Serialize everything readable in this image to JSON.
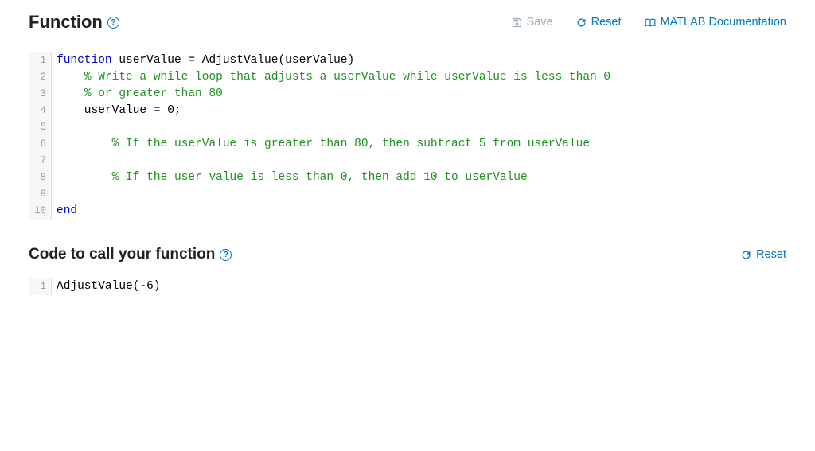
{
  "header": {
    "title": "Function",
    "actions": {
      "save": "Save",
      "reset": "Reset",
      "docs": "MATLAB Documentation"
    }
  },
  "editor1": {
    "lines": [
      {
        "n": "1",
        "segs": [
          {
            "t": "function",
            "c": "kw"
          },
          {
            "t": " userValue = AdjustValue(userValue)",
            "c": ""
          }
        ]
      },
      {
        "n": "2",
        "segs": [
          {
            "t": "    ",
            "c": ""
          },
          {
            "t": "% Write a while loop that adjusts a userValue while userValue is less than 0",
            "c": "cm"
          }
        ]
      },
      {
        "n": "3",
        "segs": [
          {
            "t": "    ",
            "c": ""
          },
          {
            "t": "% or greater than 80",
            "c": "cm"
          }
        ]
      },
      {
        "n": "4",
        "segs": [
          {
            "t": "    userValue = 0;",
            "c": ""
          }
        ]
      },
      {
        "n": "5",
        "segs": [
          {
            "t": "",
            "c": ""
          }
        ]
      },
      {
        "n": "6",
        "segs": [
          {
            "t": "        ",
            "c": ""
          },
          {
            "t": "% If the userValue is greater than 80, then subtract 5 from userValue",
            "c": "cm"
          }
        ]
      },
      {
        "n": "7",
        "segs": [
          {
            "t": "",
            "c": ""
          }
        ]
      },
      {
        "n": "8",
        "segs": [
          {
            "t": "        ",
            "c": ""
          },
          {
            "t": "% If the user value is less than 0, then add 10 to userValue",
            "c": "cm"
          }
        ]
      },
      {
        "n": "9",
        "segs": [
          {
            "t": "",
            "c": ""
          }
        ]
      },
      {
        "n": "10",
        "segs": [
          {
            "t": "end",
            "c": "kw"
          }
        ]
      }
    ]
  },
  "section2": {
    "title": "Code to call your function",
    "reset": "Reset"
  },
  "editor2": {
    "lines": [
      {
        "n": "1",
        "segs": [
          {
            "t": "AdjustValue(-6)",
            "c": ""
          }
        ]
      }
    ]
  }
}
